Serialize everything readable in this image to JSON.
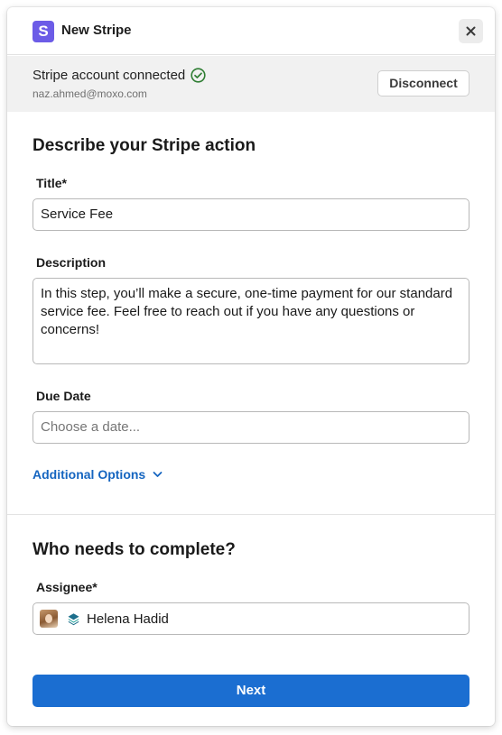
{
  "header": {
    "logo_letter": "S",
    "title": "New Stripe",
    "close_icon": "close-icon"
  },
  "connection": {
    "status": "Stripe account connected",
    "status_icon": "check-circle-icon",
    "email": "naz.ahmed@moxo.com",
    "disconnect_label": "Disconnect"
  },
  "form": {
    "section_title": "Describe your Stripe action",
    "title_label": "Title*",
    "title_value": "Service Fee",
    "description_label": "Description",
    "description_value": "In this step, you’ll make a secure, one-time payment for our standard service fee. Feel free to reach out if you have any questions or concerns!",
    "due_date_label": "Due Date",
    "due_date_placeholder": "Choose a date...",
    "additional_options_label": "Additional Options"
  },
  "assignment": {
    "section_title": "Who needs to complete?",
    "assignee_label": "Assignee*",
    "assignee_name": "Helena Hadid"
  },
  "footer": {
    "next_label": "Next"
  },
  "colors": {
    "brand": "#6c5ce7",
    "primary": "#1b6ed1",
    "link": "#1565c0",
    "success": "#2e7d32",
    "banner_bg": "#f1f1f1"
  }
}
